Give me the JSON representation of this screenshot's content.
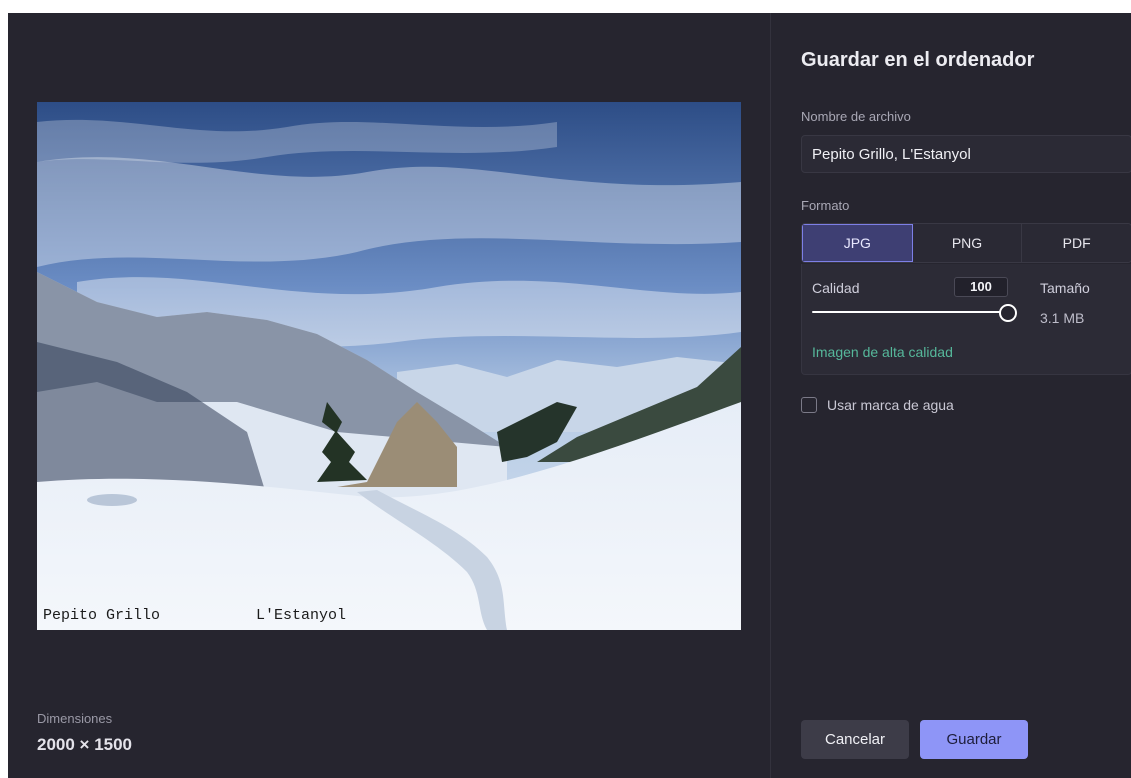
{
  "preview": {
    "caption_left": "Pepito Grillo",
    "caption_right": "L'Estanyol",
    "dimensions_label": "Dimensiones",
    "dimensions_value": "2000 × 1500"
  },
  "panel": {
    "title": "Guardar en el ordenador",
    "filename_label": "Nombre de archivo",
    "filename_value": "Pepito Grillo, L'Estanyol",
    "format_label": "Formato",
    "formats": [
      {
        "label": "JPG",
        "active": true
      },
      {
        "label": "PNG",
        "active": false
      },
      {
        "label": "PDF",
        "active": false
      }
    ],
    "quality": {
      "label": "Calidad",
      "value": "100",
      "level": 1.0,
      "hint": "Imagen de alta calidad"
    },
    "size": {
      "label": "Tamaño",
      "value": "3.1 MB"
    },
    "watermark": {
      "label": "Usar marca de agua",
      "checked": false
    },
    "buttons": {
      "cancel": "Cancelar",
      "save": "Guardar"
    }
  },
  "colors": {
    "background": "#26252f",
    "accent": "#8e95f7",
    "active_format": "#3e3f73",
    "hint_green": "#56b89b"
  }
}
